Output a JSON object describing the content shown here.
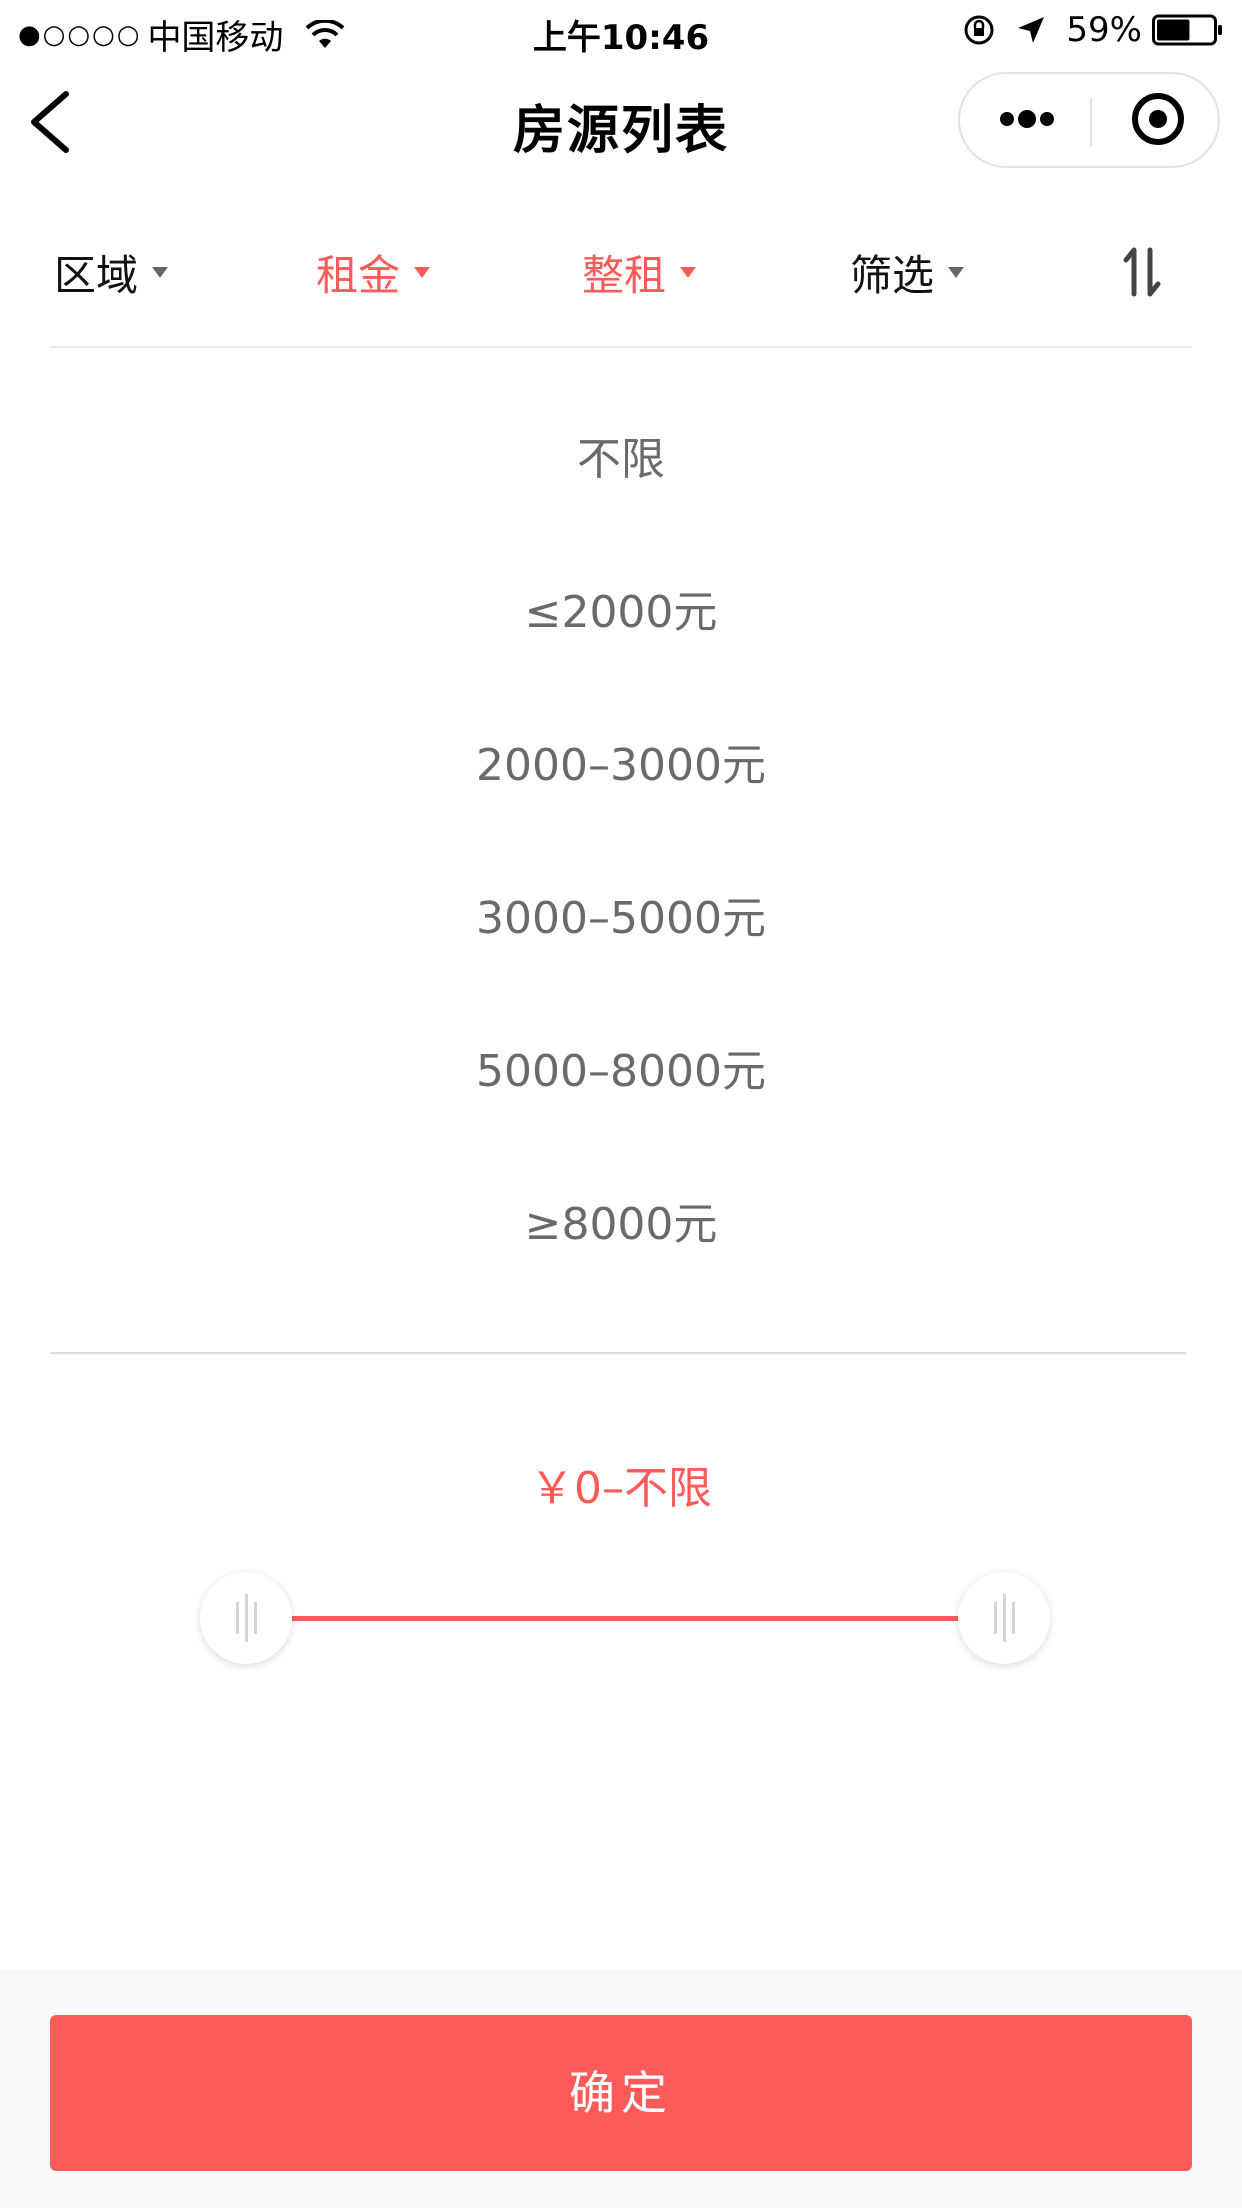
{
  "status_bar": {
    "signal": "●○○○○",
    "carrier": "中国移动",
    "time": "上午10:46",
    "battery_percent": "59%",
    "battery_level": 0.59
  },
  "nav": {
    "title": "房源列表",
    "back_icon": "chevron-left-icon",
    "more_icon": "more-dots-icon",
    "close_icon": "target-circle-icon"
  },
  "filters": {
    "tabs": [
      {
        "label": "区域",
        "active": false
      },
      {
        "label": "租金",
        "active": true
      },
      {
        "label": "整租",
        "active": true
      },
      {
        "label": "筛选",
        "active": false
      }
    ],
    "sort_icon": "sort-arrows-icon"
  },
  "price_options": [
    "不限",
    "≤2000元",
    "2000–3000元",
    "3000–5000元",
    "5000–8000元",
    "≥8000元"
  ],
  "range": {
    "label": "￥0–不限",
    "min_fraction": 0.0,
    "max_fraction": 1.0
  },
  "confirm_label": "确定",
  "colors": {
    "accent": "#fd5a5a",
    "text_primary": "#111111",
    "text_secondary": "#6a6a6a",
    "divider": "#ebebeb"
  }
}
